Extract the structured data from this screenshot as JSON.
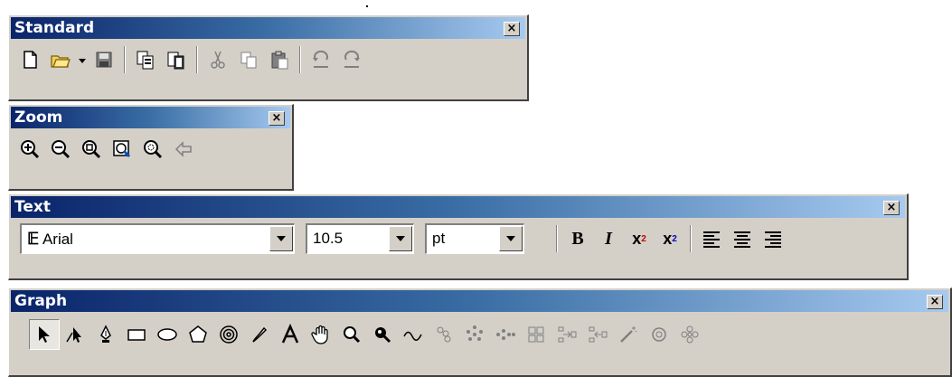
{
  "standard": {
    "title": "Standard",
    "close": "×",
    "icons": [
      "new-file-icon",
      "open-folder-icon",
      "save-disk-icon",
      "copy-page-icon",
      "paste-page-icon",
      "cut-scissors-icon",
      "copy-icon",
      "paste-icon",
      "undo-icon",
      "redo-icon"
    ]
  },
  "zoom": {
    "title": "Zoom",
    "close": "×",
    "icons": [
      "zoom-in-icon",
      "zoom-out-icon",
      "zoom-fit-icon",
      "zoom-page-icon",
      "zoom-selection-icon",
      "zoom-previous-icon"
    ]
  },
  "text": {
    "title": "Text",
    "close": "×",
    "font": "Arial",
    "size": "10.5",
    "unit": "pt",
    "bold": "B",
    "italic": "I",
    "superscript": "x",
    "sup_mark": "2",
    "subscript": "x",
    "sub_mark": "2"
  },
  "graph": {
    "title": "Graph",
    "close": "×"
  }
}
